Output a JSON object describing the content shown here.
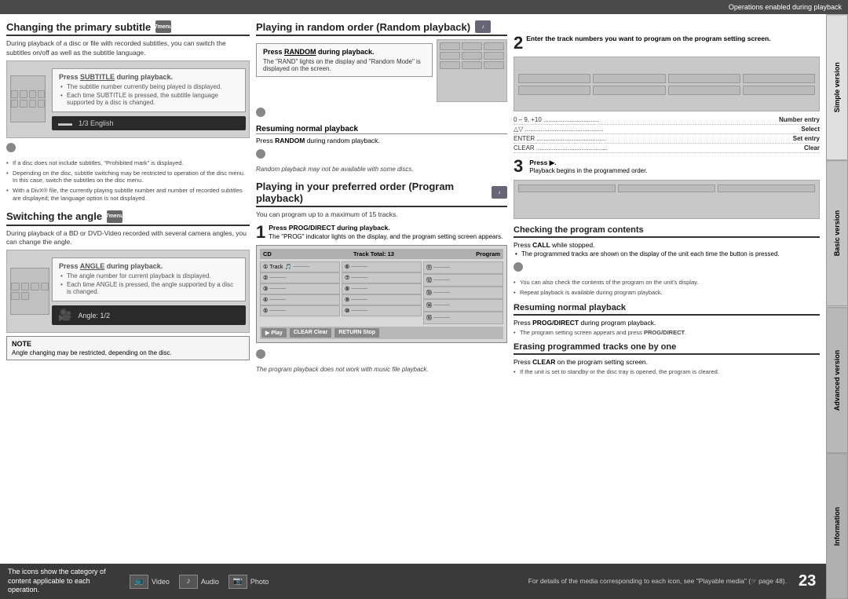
{
  "topBar": {
    "label": "Operations enabled during playback"
  },
  "sideTabs": [
    {
      "id": "simple",
      "label": "Simple version"
    },
    {
      "id": "basic",
      "label": "Basic version"
    },
    {
      "id": "advanced",
      "label": "Advanced version"
    },
    {
      "id": "information",
      "label": "Information"
    }
  ],
  "leftColumn": {
    "section1": {
      "title": "Changing the primary subtitle",
      "iconLabel": "7menu",
      "intro": "During playback of a disc or file with recorded subtitles, you can switch the subtitles on/off as well as the subtitle language.",
      "pressBox": {
        "title": "Press SUBTITLE during playback.",
        "titleKey": "SUBTITLE",
        "bullets": [
          "The subtitle number currently being played is displayed.",
          "Each time SUBTITLE is pressed, the subtitle language supported by a disc is changed."
        ]
      },
      "displayText": "1/3  English",
      "displayIcon": "▬▬",
      "notes": [
        "If a disc does not include subtitles, \"Prohibited mark\" is displayed.",
        "Depending on the disc, subtitle switching may be restricted to operation of the disc menu. In this case, switch the subtitles on the disc menu.",
        "With a DivX® file, the currently playing subtitle number and number of recorded subtitles are displayed; the language option is not displayed."
      ]
    },
    "section2": {
      "title": "Switching the angle",
      "iconLabel": "7menu",
      "intro": "During playback of a BD or DVD-Video recorded with several camera angles, you can change the angle.",
      "pressBox": {
        "title": "Press ANGLE during playback.",
        "titleKey": "ANGLE",
        "bullets": [
          "The angle number for current playback is displayed.",
          "Each time ANGLE is pressed, the angle supported by a disc is changed."
        ]
      },
      "displayText": "Angle:    1/2",
      "displayIcon": "🎥",
      "noteBox": {
        "title": "NOTE",
        "text": "Angle changing may be restricted, depending on the disc."
      }
    }
  },
  "middleColumn": {
    "section1": {
      "title": "Playing in random order (Random playback)",
      "iconLabel": "♪",
      "pressBox": {
        "title": "Press RANDOM during playback.",
        "titleKey": "RANDOM",
        "desc1": "The \"RAND\" lights on the display and \"Random Mode\" is displayed on the screen."
      },
      "resumingTitle": "Resuming normal playback",
      "resumingDesc": "Press RANDOM during random playback.",
      "resumingKey": "RANDOM",
      "note": "Random playback may not be available with some discs."
    },
    "section2": {
      "title": "Playing in your preferred order (Program playback)",
      "iconLabel": "♪",
      "intro": "You can program up to a maximum of 15 tracks.",
      "step1": {
        "num": "1",
        "title": "Press PROG/DIRECT during playback.",
        "titleKey": "PROG/DIRECT",
        "desc": "The \"PROG\" indicator lights on the display, and the program setting screen appears."
      },
      "programScreen": {
        "headerLeft": "CD",
        "headerRight": "Track Total: 13",
        "headerLabel": "Program",
        "rows": [
          [
            {
              "num": "1",
              "track": "Track",
              "icon": "🎵",
              "val": "———"
            },
            {
              "num": "6",
              "val": "———"
            },
            {
              "num": "11",
              "val": "———"
            }
          ],
          [
            {
              "num": "2",
              "val": "———"
            },
            {
              "num": "7",
              "val": "———"
            },
            {
              "num": "12",
              "val": "———"
            }
          ],
          [
            {
              "num": "3",
              "val": "———"
            },
            {
              "num": "8",
              "val": "———"
            },
            {
              "num": "13",
              "val": "———"
            }
          ],
          [
            {
              "num": "4",
              "val": "———"
            },
            {
              "num": "9",
              "val": "———"
            },
            {
              "num": "14",
              "val": "———"
            }
          ],
          [
            {
              "num": "5",
              "val": "———"
            },
            {
              "num": "10",
              "val": "———"
            },
            {
              "num": "15",
              "val": "———"
            }
          ]
        ],
        "footer": [
          {
            "label": "▶ Play"
          },
          {
            "label": "CLEAR Clear"
          },
          {
            "label": "RETURN Stop"
          }
        ]
      },
      "footerNote": "The program playback does not work with music file playback."
    }
  },
  "rightColumn": {
    "step2": {
      "num": "2",
      "desc": "Enter the track numbers you want to program on the program setting screen."
    },
    "infoRows": [
      {
        "label": "0 – 9, +10 ................................",
        "value": "Number entry"
      },
      {
        "label": "△▽ .............................................",
        "value": "Select"
      },
      {
        "label": "ENTER ........................................",
        "value": "Set entry"
      },
      {
        "label": "CLEAR .........................................",
        "value": "Clear"
      }
    ],
    "step3": {
      "num": "3",
      "title": "Press ▶.",
      "desc": "Playback begins in the programmed order."
    },
    "checking": {
      "title": "Checking the program contents",
      "pressDesc": "Press CALL while stopped.",
      "pressKey": "CALL",
      "bullets": [
        "The programmed tracks are shown on the display of the unit each time the button is pressed."
      ],
      "notes": [
        "You can also check the contents of the program on the unit's display.",
        "Repeat playback is available during program playback."
      ]
    },
    "resuming": {
      "title": "Resuming normal playback",
      "desc1": "Press PROG/DIRECT during program playback.",
      "desc1key": "PROG/DIRECT",
      "desc2": "The program setting screen appears and press PROG/DIRECT.",
      "desc2key": "PROG/DIRECT"
    },
    "erasing": {
      "title": "Erasing programmed tracks one by one",
      "pressDesc": "Press CLEAR on the program setting screen.",
      "pressKey": "CLEAR",
      "bullets": [
        "If the unit is set to standby or the disc tray is opened, the program is cleared."
      ]
    }
  },
  "bottomBar": {
    "leftText": "The icons show the category of content applicable to each operation.",
    "icons": [
      {
        "symbol": "📺",
        "label": "Video"
      },
      {
        "symbol": "♪",
        "label": "Audio"
      },
      {
        "symbol": "📷",
        "label": "Photo"
      }
    ],
    "rightDesc": "For details of the media corresponding to each icon, see \"Playable media\" (☞ page 48).",
    "pageNum": "23"
  }
}
